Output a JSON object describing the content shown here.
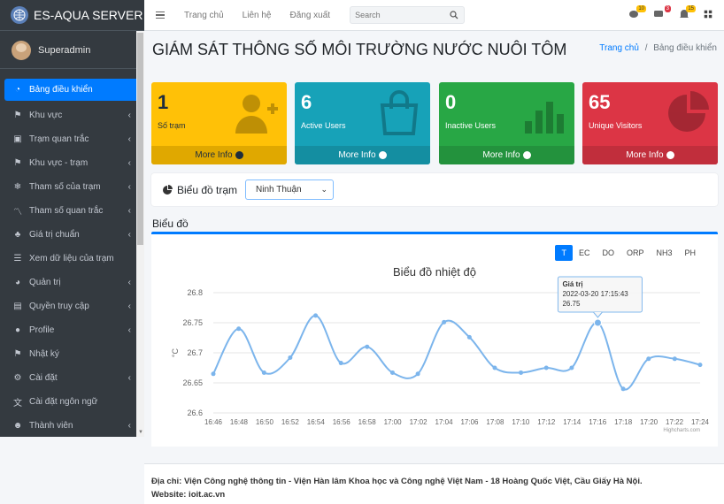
{
  "app": {
    "title": "ES-AQUA SERVER"
  },
  "user": {
    "name": "Superadmin"
  },
  "sidebar": {
    "items": [
      {
        "label": "Bảng điều khiển",
        "icon": "dashboard-icon",
        "active": true,
        "arrow": false
      },
      {
        "label": "Khu vực",
        "icon": "flag-icon",
        "arrow": true
      },
      {
        "label": "Trạm quan trắc",
        "icon": "image-icon",
        "arrow": true
      },
      {
        "label": "Khu vực - trạm",
        "icon": "flag-icon",
        "arrow": true
      },
      {
        "label": "Tham số của trạm",
        "icon": "snowflake-icon",
        "arrow": true
      },
      {
        "label": "Tham số quan trắc",
        "icon": "line-chart-icon",
        "arrow": true
      },
      {
        "label": "Giá trị chuẩn",
        "icon": "tree-icon",
        "arrow": true
      },
      {
        "label": "Xem dữ liệu của trạm",
        "icon": "database-icon",
        "arrow": false
      },
      {
        "label": "Quản trị",
        "icon": "pie-icon",
        "arrow": true
      },
      {
        "label": "Quyền truy cập",
        "icon": "book-icon",
        "arrow": true
      },
      {
        "label": "Profile",
        "icon": "user-icon",
        "arrow": true
      },
      {
        "label": "Nhật ký",
        "icon": "flag-icon",
        "arrow": false
      },
      {
        "label": "Cài đặt",
        "icon": "cogs-icon",
        "arrow": true
      },
      {
        "label": "Cài đặt ngôn ngữ",
        "icon": "language-icon",
        "arrow": false
      },
      {
        "label": "Thành viên",
        "icon": "users-icon",
        "arrow": true
      }
    ]
  },
  "topbar": {
    "links": [
      "Trang chủ",
      "Liên hệ",
      "Đăng xuất"
    ],
    "search_placeholder": "Search",
    "badges": [
      {
        "icon": "messages-icon",
        "count": "10",
        "color": "#ffc107"
      },
      {
        "icon": "comments-icon",
        "count": "3",
        "color": "#dc3545"
      },
      {
        "icon": "bell-icon",
        "count": "15",
        "color": "#ffc107"
      }
    ]
  },
  "page": {
    "title": "GIÁM SÁT THÔNG SỐ MÔI TRƯỜNG NƯỚC NUÔI TÔM",
    "breadcrumb_home": "Trang chủ",
    "breadcrumb_sep": "/",
    "breadcrumb_current": "Bảng điều khiển"
  },
  "boxes": [
    {
      "value": "1",
      "label": "Số trạm",
      "footer": "More Info",
      "color": "yellow",
      "icon": "user-plus-icon"
    },
    {
      "value": "6",
      "label": "Active Users",
      "footer": "More Info",
      "color": "cyan",
      "icon": "shopping-bag-icon"
    },
    {
      "value": "0",
      "label": "Inactive Users",
      "footer": "More Info",
      "color": "green",
      "icon": "bar-chart-icon"
    },
    {
      "value": "65",
      "label": "Unique Visitors",
      "footer": "More Info",
      "color": "red",
      "icon": "pie-chart-icon"
    }
  ],
  "station": {
    "label": "Biểu đồ trạm",
    "selected": "Ninh Thuận"
  },
  "section_title": "Biểu đồ",
  "tabs": [
    {
      "label": "T",
      "active": true
    },
    {
      "label": "EC",
      "active": false
    },
    {
      "label": "DO",
      "active": false
    },
    {
      "label": "ORP",
      "active": false
    },
    {
      "label": "NH3",
      "active": false
    },
    {
      "label": "PH",
      "active": false
    }
  ],
  "tooltip": {
    "title": "Giá trị",
    "time": "2022-03-20 17:15:43",
    "value": "26.75"
  },
  "chart_data": {
    "type": "line",
    "title": "Biểu đồ nhiệt độ",
    "ylabel": "°C",
    "credits": "Highcharts.com",
    "x_ticks": [
      "16:46",
      "16:48",
      "16:50",
      "16:52",
      "16:54",
      "16:56",
      "16:58",
      "17:00",
      "17:02",
      "17:04",
      "17:06",
      "17:08",
      "17:10",
      "17:12",
      "17:14",
      "17:16",
      "17:18",
      "17:20",
      "17:22",
      "17:24"
    ],
    "y_ticks": [
      26.6,
      26.65,
      26.7,
      26.75,
      26.8
    ],
    "ylim": [
      26.6,
      26.8
    ],
    "xlim": [
      16.767,
      17.4
    ],
    "points": [
      [
        16.767,
        26.665
      ],
      [
        16.8,
        26.74
      ],
      [
        16.833,
        26.667
      ],
      [
        16.867,
        26.692
      ],
      [
        16.9,
        26.762
      ],
      [
        16.933,
        26.683
      ],
      [
        16.967,
        26.71
      ],
      [
        17.0,
        26.667
      ],
      [
        17.033,
        26.665
      ],
      [
        17.067,
        26.751
      ],
      [
        17.1,
        26.726
      ],
      [
        17.133,
        26.675
      ],
      [
        17.167,
        26.667
      ],
      [
        17.2,
        26.675
      ],
      [
        17.233,
        26.675
      ],
      [
        17.267,
        26.75
      ],
      [
        17.3,
        26.64
      ],
      [
        17.333,
        26.69
      ],
      [
        17.367,
        26.69
      ],
      [
        17.4,
        26.68
      ]
    ],
    "grid": true,
    "legend": "none",
    "line_color": "#7cb5ec"
  },
  "footer": {
    "address": "Địa chỉ: Viện Công nghệ thông tin - Viện Hàn lâm Khoa học và Công nghệ Việt Nam - 18 Hoàng Quốc Việt, Cầu Giấy Hà Nội.",
    "website": "Website: ioit.ac.vn"
  }
}
